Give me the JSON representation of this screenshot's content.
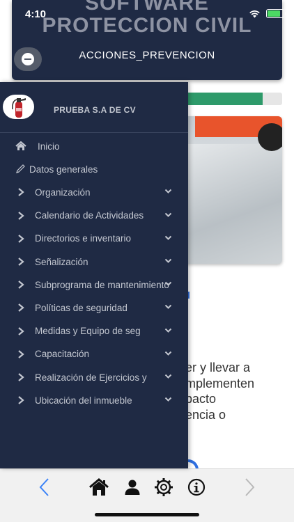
{
  "status_bar": {
    "time": "4:10",
    "icons": [
      "wifi-icon",
      "battery-icon"
    ],
    "battery_color": "#4cd964"
  },
  "header": {
    "title_line1": "SOFTWARE",
    "title_line2": "PROTECCION CIVIL",
    "subtitle": "ACCIONES_PREVENCION",
    "bg_color": "#1f2a44"
  },
  "drawer": {
    "company_name": "PRUEBA S.A DE CV",
    "logo_icon": "fire-extinguisher-icon",
    "items": [
      {
        "label": "Inicio",
        "icon": "home-icon",
        "expandable": false
      },
      {
        "label": "Datos generales",
        "icon": "pencil-icon",
        "expandable": false
      },
      {
        "label": "Organización",
        "icon": "chevron-right-icon",
        "expandable": true
      },
      {
        "label": "Calendario de Actividades",
        "icon": "chevron-right-icon",
        "expandable": true
      },
      {
        "label": "Directorios e inventario",
        "icon": "chevron-right-icon",
        "expandable": true
      },
      {
        "label": "Señalización",
        "icon": "chevron-right-icon",
        "expandable": true
      },
      {
        "label": "Subprograma de mantenimiento",
        "icon": "chevron-right-icon",
        "expandable": true
      },
      {
        "label": "Políticas de seguridad",
        "icon": "chevron-right-icon",
        "expandable": true
      },
      {
        "label": "Medidas y Equipo de seg",
        "icon": "chevron-right-icon",
        "expandable": true
      },
      {
        "label": "Capacitación",
        "icon": "chevron-right-icon",
        "expandable": true
      },
      {
        "label": "Realización de Ejercicios y",
        "icon": "chevron-right-icon",
        "expandable": true
      },
      {
        "label": "Ubicación del inmueble",
        "icon": "chevron-right-icon",
        "expandable": true
      }
    ]
  },
  "background": {
    "progress": 0.82,
    "progress_color": "#2e9a6a",
    "text_lines": [
      "er y llevar a",
      "mplementen",
      "pacto",
      "encia o"
    ]
  },
  "bottom_bar": {
    "icons": [
      "back-arrow-icon",
      "home-icon",
      "user-icon",
      "settings-gear-icon",
      "info-icon",
      "forward-arrow-icon"
    ]
  }
}
